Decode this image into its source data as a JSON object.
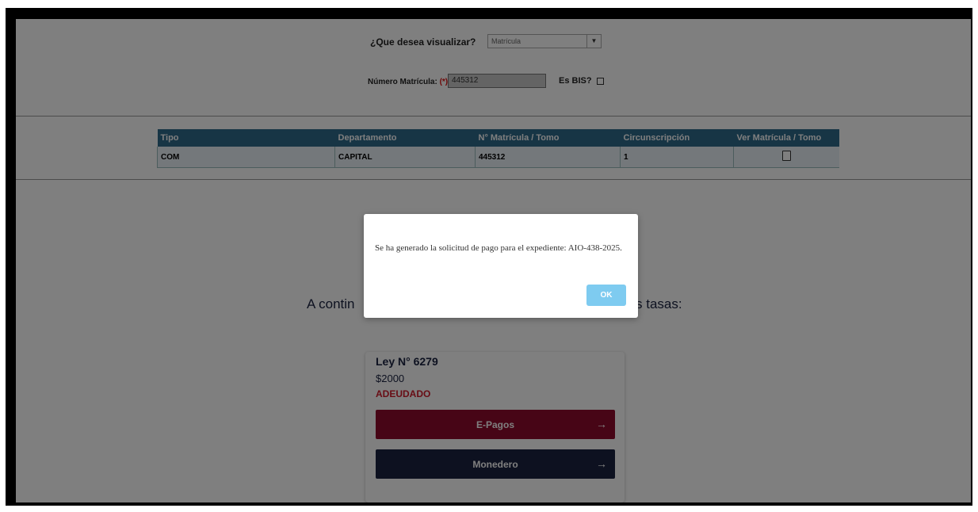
{
  "query": {
    "label": "¿Que desea visualizar?",
    "selected": "Matrícula",
    "numero_label": "Número Matrícula:",
    "required_mark": "(*)",
    "numero_value": "445312",
    "bis_label": "Es BIS?"
  },
  "table": {
    "headers": [
      "Tipo",
      "Departamento",
      "N° Matrícula / Tomo",
      "Circunscripción",
      "Ver Matrícula / Tomo"
    ],
    "rows": [
      {
        "tipo": "COM",
        "departamento": "CAPITAL",
        "matricula": "445312",
        "circunscripcion": "1"
      }
    ]
  },
  "continuation": {
    "left": "A contin",
    "right": "s tasas:"
  },
  "card": {
    "ley": "Ley N° 6279",
    "price": "$2000",
    "status": "ADEUDADO",
    "epagos_label": "E-Pagos",
    "monedero_label": "Monedero",
    "arrow": "→"
  },
  "dialog": {
    "message": "Se ha generado la solicitud de pago para el expediente: AIO-438-2025.",
    "ok_label": "OK"
  },
  "colors": {
    "header_bg": "#2f6a8a",
    "epagos": "#8f0b2c",
    "monedero": "#1a2340",
    "ok_button": "#7ecbf0",
    "status": "#d11a2a"
  },
  "icons": {
    "select_arrow": "▼"
  }
}
